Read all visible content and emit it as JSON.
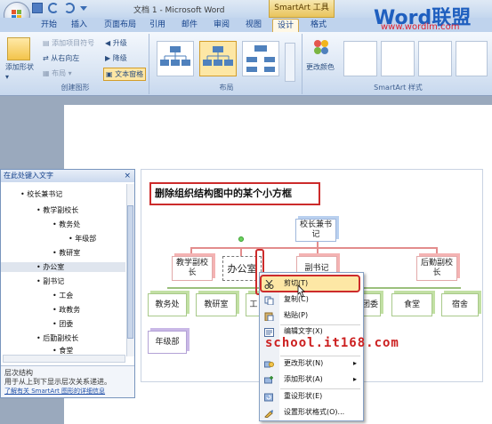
{
  "titlebar": {
    "title": "文档 1 - Microsoft Word",
    "smartart_tools": "SmartArt 工具"
  },
  "tabs": [
    {
      "label": "开始"
    },
    {
      "label": "插入"
    },
    {
      "label": "页面布局"
    },
    {
      "label": "引用"
    },
    {
      "label": "邮件"
    },
    {
      "label": "审阅"
    },
    {
      "label": "视图"
    },
    {
      "label": "设计"
    },
    {
      "label": "格式"
    }
  ],
  "ribbon": {
    "create_group": {
      "label": "创建图形",
      "add_shape": "添加形状",
      "add_bullet": "添加项目符号",
      "right_to_left": "从右向左",
      "layout": "布局",
      "promote": "升级",
      "demote": "降级",
      "text_pane": "文本窗格"
    },
    "layout_group": {
      "label": "布局"
    },
    "styles_group": {
      "label": "SmartArt 样式",
      "change_colors": "更改颜色"
    }
  },
  "logo": {
    "brand": "Word联盟",
    "url": "www.wordlm.com"
  },
  "text_pane": {
    "title": "在此处键入文字",
    "close": "×",
    "items": [
      {
        "text": "校长兼书记",
        "level": 0
      },
      {
        "text": "教学副校长",
        "level": 1
      },
      {
        "text": "教务处",
        "level": 2
      },
      {
        "text": "年级部",
        "level": 3
      },
      {
        "text": "教研室",
        "level": 2
      },
      {
        "text": "办公室",
        "level": 1,
        "selected": true
      },
      {
        "text": "副书记",
        "level": 1
      },
      {
        "text": "工会",
        "level": 2
      },
      {
        "text": "政教务",
        "level": 2
      },
      {
        "text": "团委",
        "level": 2
      },
      {
        "text": "后勤副校长",
        "level": 1
      },
      {
        "text": "食堂",
        "level": 2
      }
    ],
    "footer_title": "层次结构",
    "footer_desc": "用于从上到下显示层次关系递进。",
    "footer_link": "了解有关 SmartArt 图形的详细信息"
  },
  "diagram": {
    "heading": "删除组织结构图中的某个小方框",
    "top": "校长兼书记",
    "level1": [
      "教学副校长",
      "办公室",
      "副书记",
      "后勤副校长"
    ],
    "level2": [
      "教务处",
      "教研室",
      "工",
      "团委",
      "食堂",
      "宿舍"
    ],
    "level3": [
      "年级部"
    ]
  },
  "context_menu": {
    "items": [
      {
        "label": "剪切(T)",
        "icon": "scissors-icon",
        "highlight": true
      },
      {
        "label": "复制(C)",
        "icon": "copy-icon"
      },
      {
        "label": "粘贴(P)",
        "icon": "paste-icon"
      },
      {
        "label": "编辑文字(X)",
        "icon": "edit-text-icon"
      },
      {
        "label": "",
        "icon": "none"
      },
      {
        "label": "更改形状(N)",
        "icon": "change-shape-icon",
        "submenu": true
      },
      {
        "label": "添加形状(A)",
        "icon": "add-shape-icon",
        "submenu": true
      },
      {
        "label": "重设形状(E)",
        "icon": "reset-shape-icon"
      },
      {
        "label": "设置形状格式(O)...",
        "icon": "format-shape-icon"
      }
    ]
  },
  "watermark": "school.it168.com",
  "colors": {
    "accent_red": "#cc2b2b",
    "ribbon_blue": "#bfd3ed",
    "highlight_yellow": "#fde7a5",
    "logo_red": "#d23",
    "logo_blue": "#1f5fbf"
  }
}
